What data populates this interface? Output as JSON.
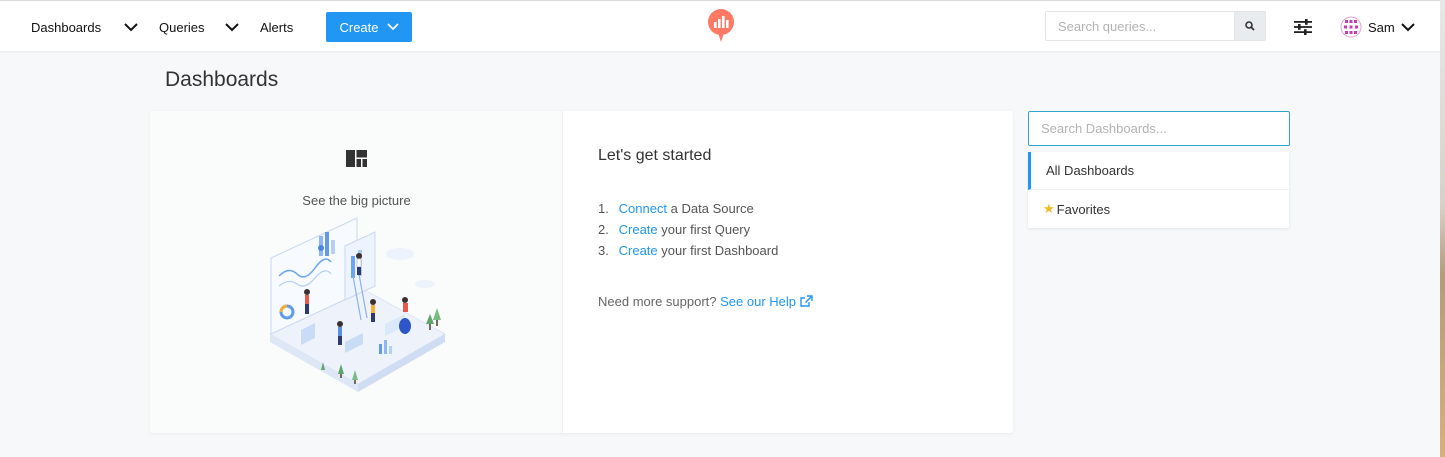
{
  "nav": {
    "dashboards_label": "Dashboards",
    "queries_label": "Queries",
    "alerts_label": "Alerts",
    "create_label": "Create",
    "search_placeholder": "Search queries...",
    "user_name": "Sam"
  },
  "page": {
    "title": "Dashboards"
  },
  "empty_state": {
    "caption": "See the big picture",
    "title": "Let's get started",
    "steps": [
      {
        "num": "1.",
        "link": "Connect",
        "text": " a Data Source"
      },
      {
        "num": "2.",
        "link": "Create",
        "text": " your first Query"
      },
      {
        "num": "3.",
        "link": "Create",
        "text": " your first Dashboard"
      }
    ],
    "support_text": "Need more support? ",
    "support_link": "See our Help"
  },
  "sidebar": {
    "search_placeholder": "Search Dashboards...",
    "items": [
      {
        "label": "All Dashboards"
      },
      {
        "label": "Favorites"
      }
    ]
  },
  "colors": {
    "accent": "#2196f3",
    "logo": "#ff7964",
    "star": "#f6b81d",
    "search_focus": "#2ea6c9"
  }
}
